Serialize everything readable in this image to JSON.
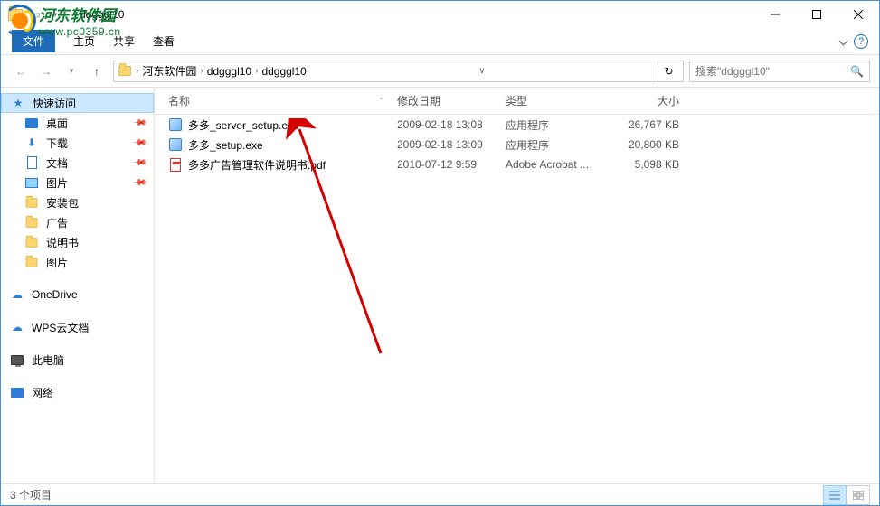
{
  "window": {
    "title": "ddgggl10",
    "watermark_title": "河东软件园",
    "watermark_url": "www.pc0359.cn"
  },
  "ribbon": {
    "file": "文件",
    "home": "主页",
    "share": "共享",
    "view": "查看"
  },
  "breadcrumb": {
    "root": "河东软件园",
    "seg1": "ddgggl10",
    "seg2": "ddgggl10"
  },
  "search": {
    "placeholder": "搜索\"ddgggl10\""
  },
  "sidebar": {
    "quick_access": "快速访问",
    "desktop": "桌面",
    "downloads": "下载",
    "documents": "文档",
    "pictures": "图片",
    "install_pkg": "安装包",
    "ads": "广告",
    "manual": "说明书",
    "pictures2": "图片",
    "onedrive": "OneDrive",
    "wps_cloud": "WPS云文档",
    "this_pc": "此电脑",
    "network": "网络"
  },
  "columns": {
    "name": "名称",
    "date": "修改日期",
    "type": "类型",
    "size": "大小"
  },
  "files": [
    {
      "icon": "exe",
      "name": "多多_server_setup.exe",
      "date": "2009-02-18 13:08",
      "type": "应用程序",
      "size": "26,767 KB"
    },
    {
      "icon": "exe",
      "name": "多多_setup.exe",
      "date": "2009-02-18 13:09",
      "type": "应用程序",
      "size": "20,800 KB"
    },
    {
      "icon": "pdf",
      "name": "多多广告管理软件说明书.pdf",
      "date": "2010-07-12 9:59",
      "type": "Adobe Acrobat ...",
      "size": "5,098 KB"
    }
  ],
  "status": {
    "count": "3 个项目"
  }
}
